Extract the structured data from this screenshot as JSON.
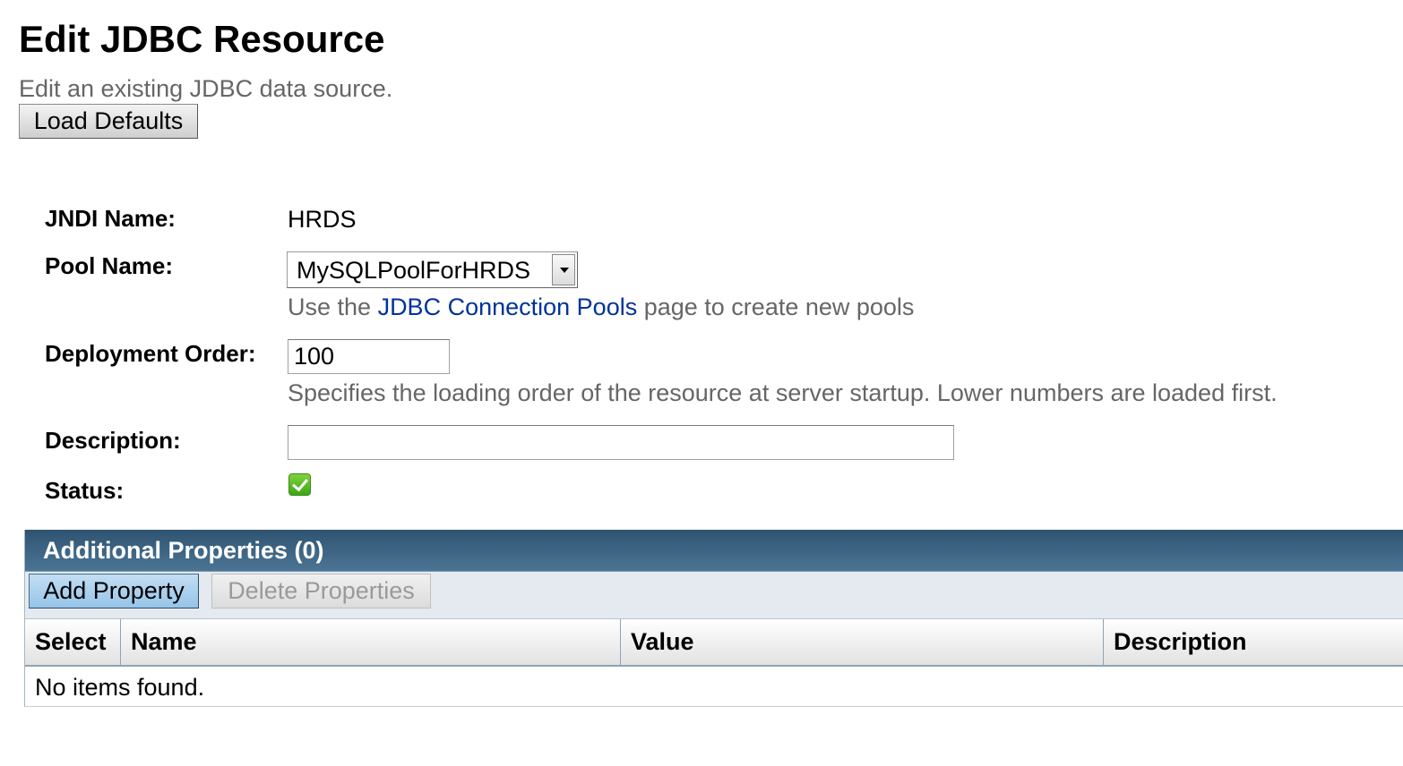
{
  "page": {
    "title": "Edit JDBC Resource",
    "help": "Edit an existing JDBC data source.",
    "load_defaults_label": "Load Defaults"
  },
  "form": {
    "jndi_name": {
      "label": "JNDI Name:",
      "value": "HRDS"
    },
    "pool_name": {
      "label": "Pool Name:",
      "selected": "MySQLPoolForHRDS",
      "help_prefix": "Use the ",
      "help_link": "JDBC Connection Pools",
      "help_suffix": " page to create new pools"
    },
    "deployment_order": {
      "label": "Deployment Order:",
      "value": "100",
      "help": "Specifies the loading order of the resource at server startup. Lower numbers are loaded first."
    },
    "description": {
      "label": "Description:",
      "value": ""
    },
    "status": {
      "label": "Status:",
      "checked": true
    }
  },
  "properties_table": {
    "title": "Additional Properties (0)",
    "add_label": "Add Property",
    "delete_label": "Delete Properties",
    "columns": [
      "Select",
      "Name",
      "Value",
      "Description"
    ],
    "empty_message": "No items found."
  },
  "colors": {
    "title_bar": "#2f5472",
    "link": "#003399",
    "help_text": "#666666",
    "checkbox": "#3ea516"
  }
}
